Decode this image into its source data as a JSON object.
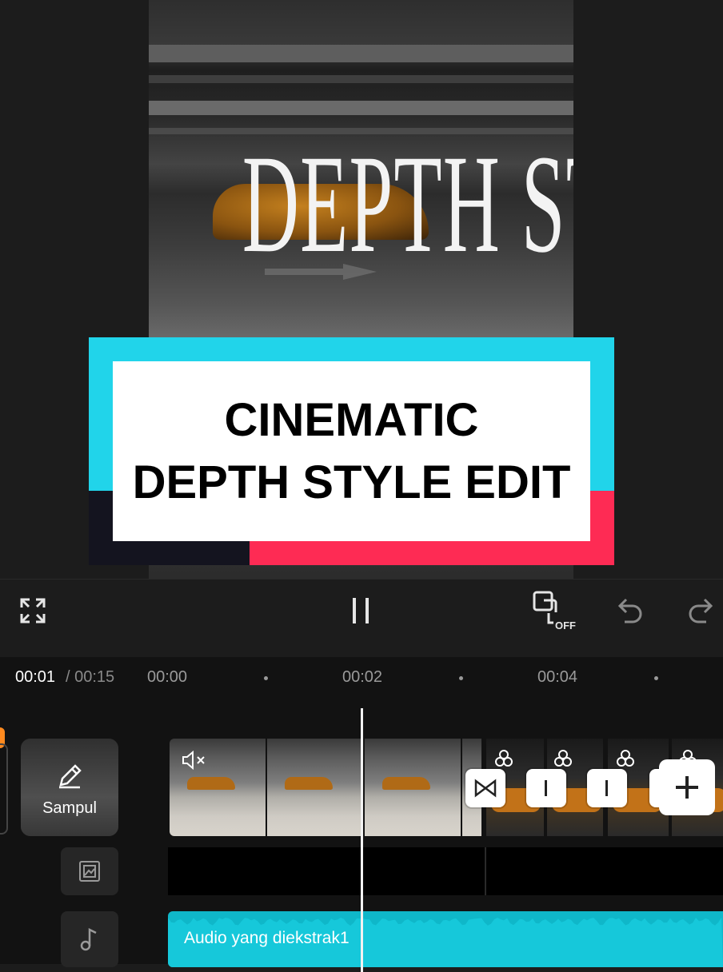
{
  "preview": {
    "video_title": "DEPTH STYLE",
    "banner_line1": "CINEMATIC",
    "banner_line2": "DEPTH STYLE EDIT"
  },
  "toolbar": {
    "fullscreen_icon": "fullscreen-icon",
    "pause_icon": "pause-icon",
    "keyframe_icon": "keyframe-off-icon",
    "keyframe_badge": "OFF",
    "undo_icon": "undo-icon",
    "redo_icon": "redo-icon"
  },
  "timeline": {
    "current_time": "00:01",
    "total_time": "/ 00:15",
    "ticks": [
      "00:00",
      "00:02",
      "00:04"
    ],
    "cover_label": "Sampul",
    "audio_label": "Audio yang diekstrak1"
  },
  "colors": {
    "banner_cyan": "#21d4ea",
    "banner_red": "#fe2b54",
    "banner_dark": "#14141f",
    "audio_track": "#0fb7c9",
    "accent_orange": "#ff8a1f"
  }
}
